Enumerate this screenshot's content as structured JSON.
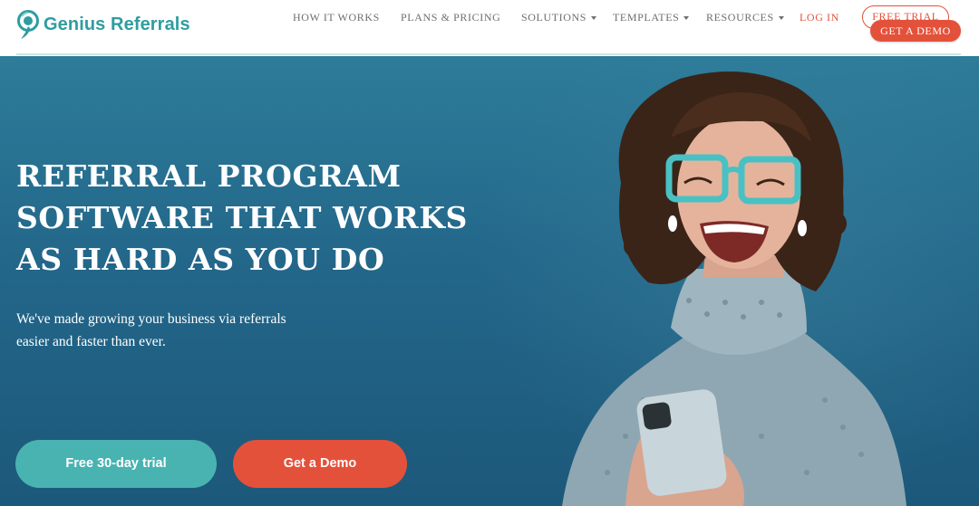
{
  "brand": {
    "name": "Genius Referrals",
    "color": "#2e9da0",
    "accent": "#e4513a"
  },
  "nav": {
    "items": [
      {
        "label": "HOW IT WORKS",
        "has_dropdown": false
      },
      {
        "label": "PLANS & PRICING",
        "has_dropdown": false
      },
      {
        "label": "SOLUTIONS",
        "has_dropdown": true
      },
      {
        "label": "TEMPLATES",
        "has_dropdown": true
      },
      {
        "label": "RESOURCES",
        "has_dropdown": true
      }
    ],
    "login_label": "LOG IN",
    "free_trial_label": "FREE TRIAL",
    "demo_label": "GET A DEMO"
  },
  "hero": {
    "title_lines": [
      "REFERRAL PROGRAM",
      "SOFTWARE THAT WORKS",
      "AS HARD AS YOU DO"
    ],
    "subtitle_lines": [
      "We've made growing your business via referrals",
      "easier and faster than ever."
    ],
    "cta_trial_label": "Free 30-day trial",
    "cta_demo_label": "Get a Demo",
    "bg_color": "#23678a",
    "trial_color": "#48b3b1"
  },
  "icons": {
    "logo": "logo-mark-icon",
    "dropdown": "chevron-down-icon"
  }
}
